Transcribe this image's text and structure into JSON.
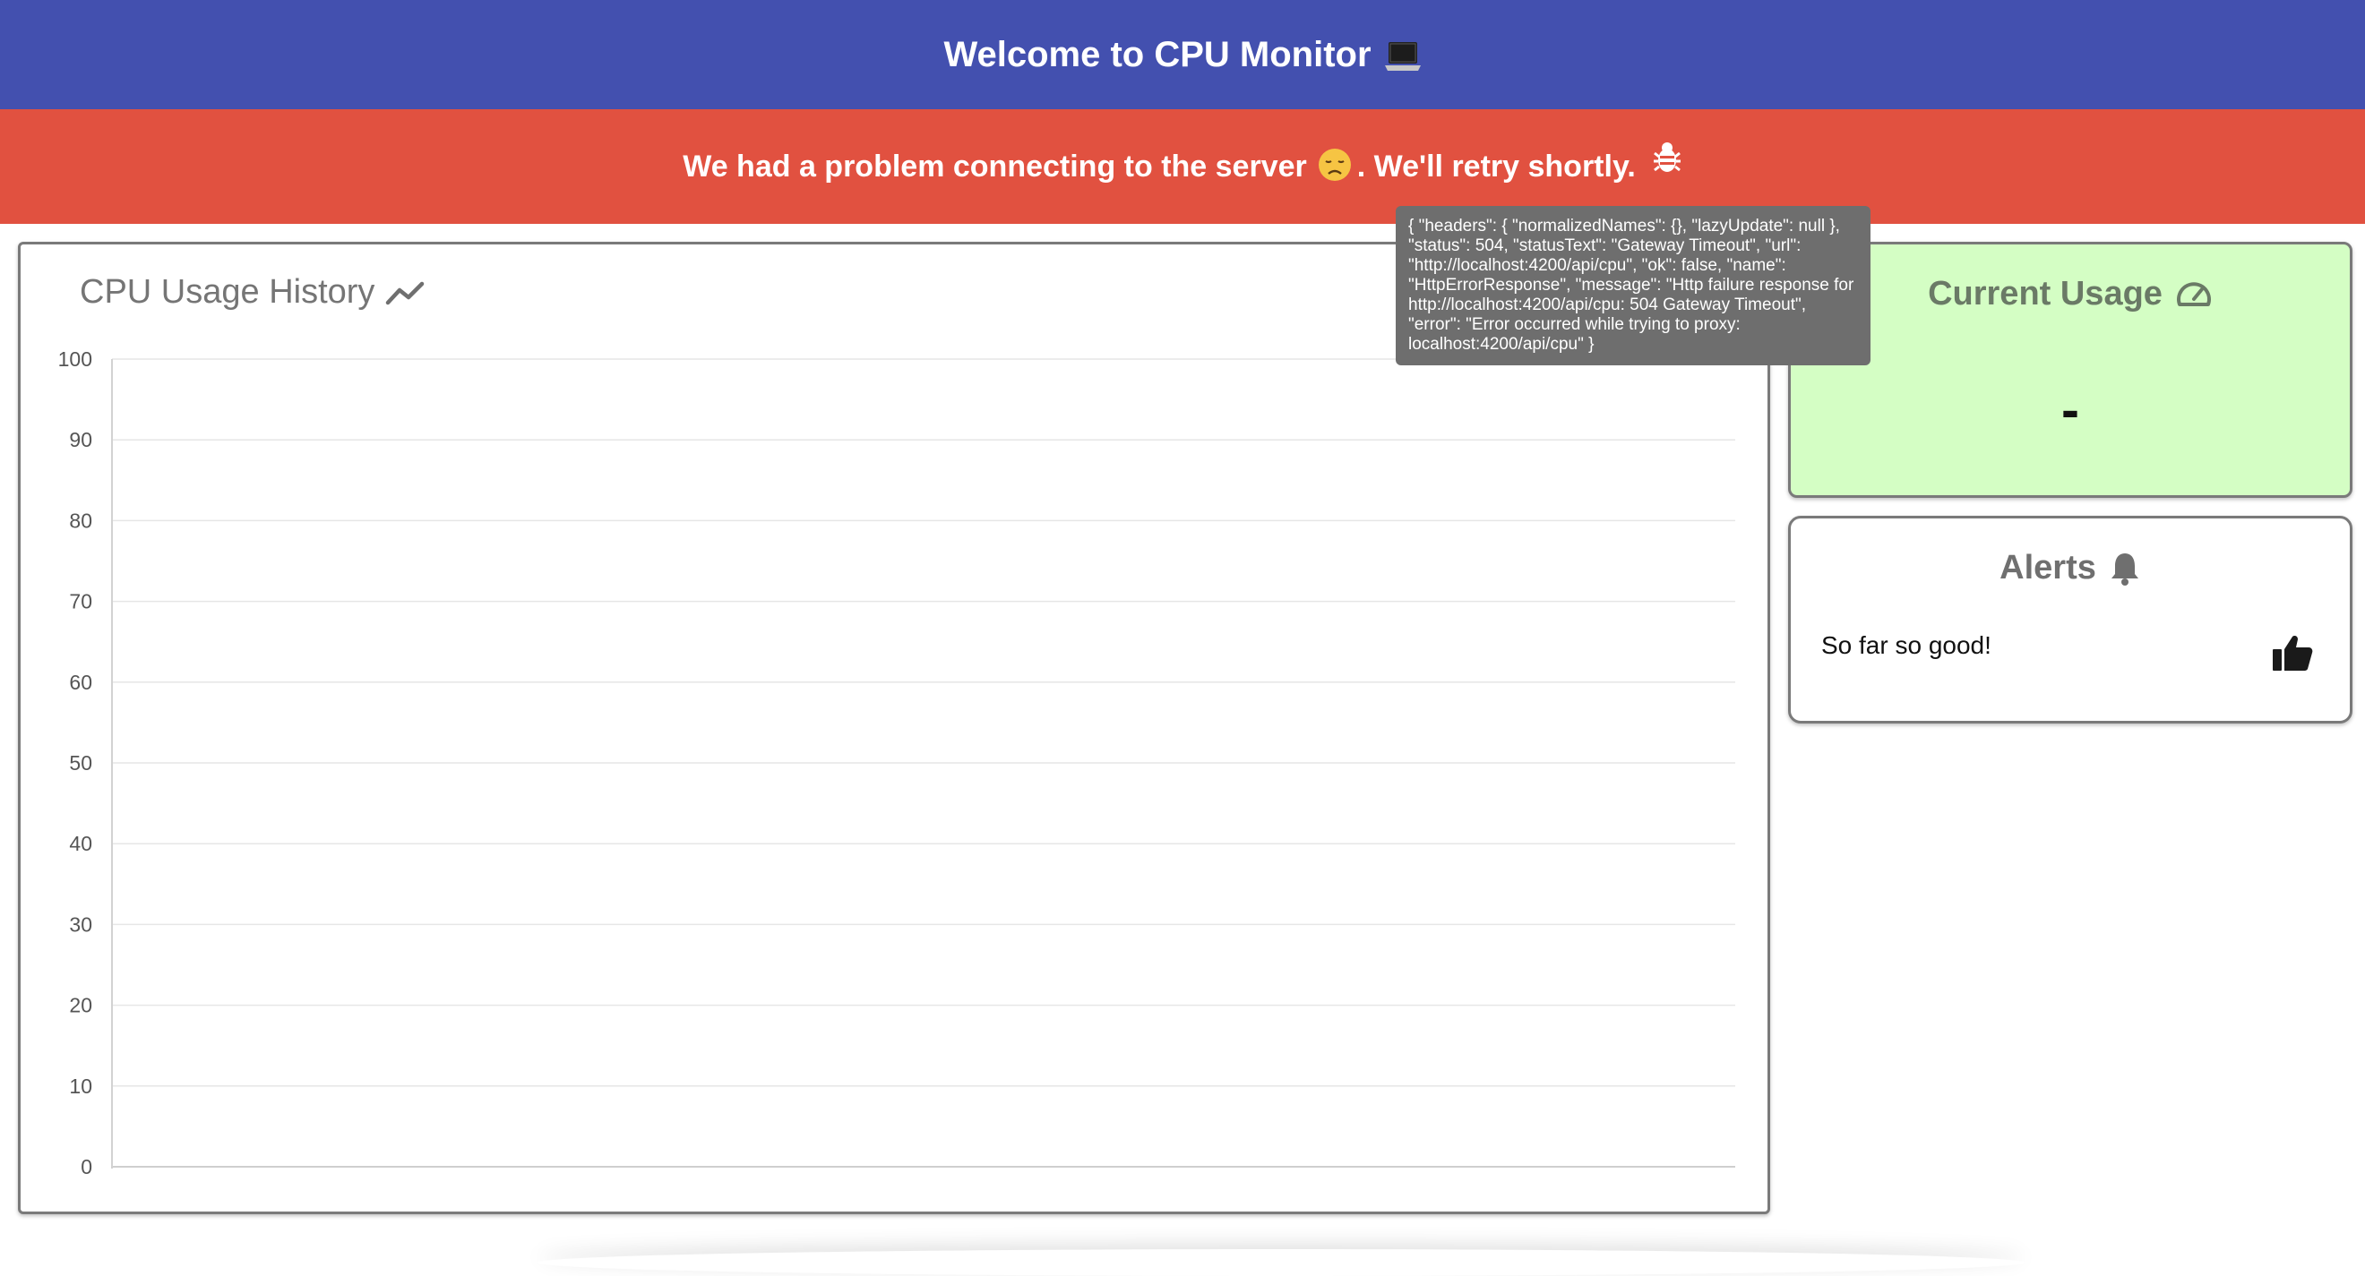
{
  "header": {
    "title": "Welcome to CPU Monitor",
    "icon": "laptop-icon",
    "background": "#4350af"
  },
  "banner": {
    "message_before": "We had a problem connecting to the server",
    "message_after": ". We'll retry shortly.",
    "icons": [
      "sad-face-icon",
      "bug-icon"
    ],
    "background": "#e15140"
  },
  "tooltip": {
    "text": "{ \"headers\": { \"normalizedNames\": {}, \"lazyUpdate\": null }, \"status\": 504, \"statusText\": \"Gateway Timeout\", \"url\": \"http://localhost:4200/api/cpu\", \"ok\": false, \"name\": \"HttpErrorResponse\", \"message\": \"Http failure response for http://localhost:4200/api/cpu: 504 Gateway Timeout\", \"error\": \"Error occurred while trying to proxy: localhost:4200/api/cpu\" }"
  },
  "history": {
    "title": "CPU Usage History",
    "icon": "trending-line-icon"
  },
  "chart_data": {
    "type": "line",
    "title": "",
    "xlabel": "",
    "ylabel": "",
    "ylim": [
      0,
      100
    ],
    "yticks": [
      100,
      90,
      80,
      70,
      60,
      50,
      40,
      30,
      20,
      10,
      0
    ],
    "series": [],
    "grid": true
  },
  "current_usage": {
    "title": "Current Usage",
    "icon": "speedometer-icon",
    "value": "-",
    "background": "#d4fec4"
  },
  "alerts": {
    "title": "Alerts",
    "icon": "bell-icon",
    "message": "So far so good!",
    "status_icon": "thumbs-up-icon"
  }
}
